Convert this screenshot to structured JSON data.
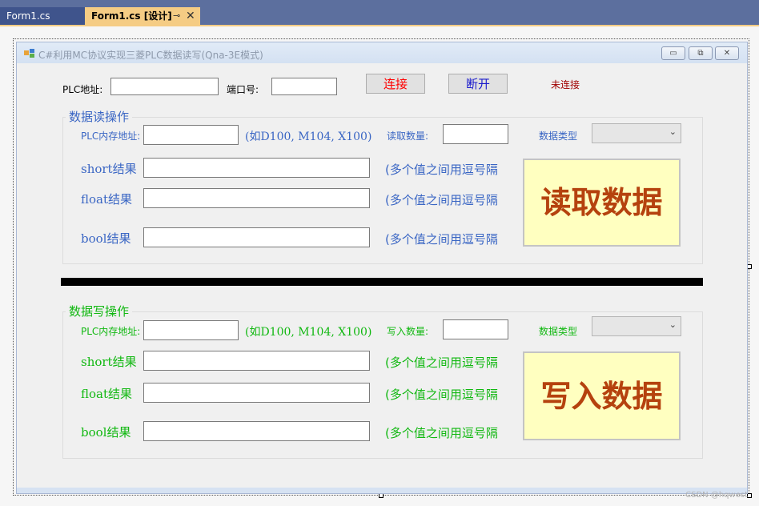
{
  "tabs": {
    "inactive": "Form1.cs",
    "active": "Form1.cs [设计]",
    "pin_icon": "pin-icon",
    "close_icon": "close-icon"
  },
  "window": {
    "title": "C#利用MC协议实现三菱PLC数据读写(Qna-3E模式)",
    "minimize": "▭",
    "restore": "⧉",
    "close": "✕"
  },
  "connection": {
    "plc_address_label": "PLC地址:",
    "port_label": "端口号:",
    "plc_address_value": "",
    "port_value": "",
    "connect_label": "连接",
    "disconnect_label": "断开",
    "status": "未连接"
  },
  "read": {
    "group_title": "数据读操作",
    "address_label": "PLC内存地址:",
    "address_hint": "(如D100, M104, X100)",
    "count_label": "读取数量:",
    "type_label": "数据类型",
    "short_label": "short结果",
    "float_label": "float结果",
    "bool_label": "bool结果",
    "multi_hint": "(多个值之间用逗号隔",
    "action_label": "读取数据"
  },
  "write": {
    "group_title": "数据写操作",
    "address_label": "PLC内存地址:",
    "address_hint": "(如D100, M104, X100)",
    "count_label": "写入数量:",
    "type_label": "数据类型",
    "short_label": "short结果",
    "float_label": "float结果",
    "bool_label": "bool结果",
    "multi_hint": "(多个值之间用逗号隔",
    "action_label": "写入数据"
  },
  "watermark": "CSDN @hqwest",
  "colors": {
    "read_text": "#3a66c4",
    "write_text": "#11b811",
    "connect_text": "#ff0000",
    "disconnect_text": "#1a1acc",
    "status_text": "#a00000",
    "action_button_bg": "#ffffc0",
    "action_text": "#b5420e"
  }
}
